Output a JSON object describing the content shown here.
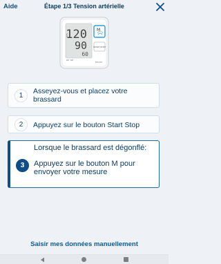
{
  "header": {
    "help_label": "Aide",
    "title": "Étape 1/3 Tension artérielle"
  },
  "device": {
    "systolic": "120",
    "diastolic": "90",
    "pulse": "60",
    "m_button_label": "M",
    "start_stop_label": "START STOP",
    "brand": "beurer"
  },
  "steps": [
    {
      "number": "1",
      "text": "Asseyez-vous et placez votre brassard"
    },
    {
      "number": "2",
      "text": "Appuyez sur le bouton Start Stop"
    },
    {
      "number": "3",
      "text_line1": "Lorsque le brassard est dégonflé:",
      "text_line2": "Appuyez sur le bouton M pour envoyer votre mesure"
    }
  ],
  "footer": {
    "manual_entry_label": "Saisir mes données manuellement"
  },
  "colors": {
    "primary": "#0e4d86",
    "highlight": "#2b9bd6",
    "background": "#eef2f6"
  }
}
